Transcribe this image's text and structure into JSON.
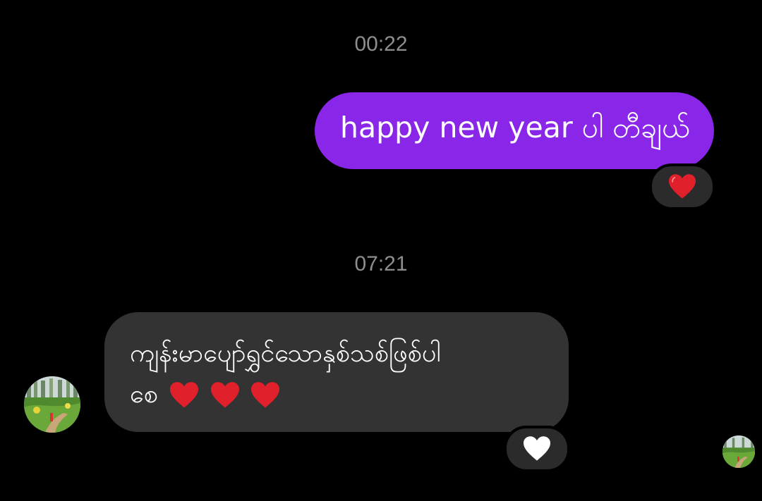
{
  "timestamps": [
    "00:22",
    "07:21"
  ],
  "messages": {
    "outgoing": {
      "text": "happy new year ပါ တီချယ်",
      "reaction": "red-heart-icon"
    },
    "incoming": {
      "line1": "ကျန်းမာပျော်ရွှင်သောနှစ်သစ်ဖြစ်ပါ",
      "line2": "စေ",
      "trailing_icons": [
        "red-heart-icon",
        "red-heart-icon",
        "red-heart-icon"
      ],
      "reaction": "white-heart-icon"
    }
  },
  "colors": {
    "background": "#000000",
    "outgoing_bubble": "#8a26e8",
    "incoming_bubble": "#333333",
    "timestamp": "#8e8e8e",
    "reaction_pill": "#2b2b2b",
    "heart_red": "#e0202b",
    "heart_white": "#ffffff"
  }
}
